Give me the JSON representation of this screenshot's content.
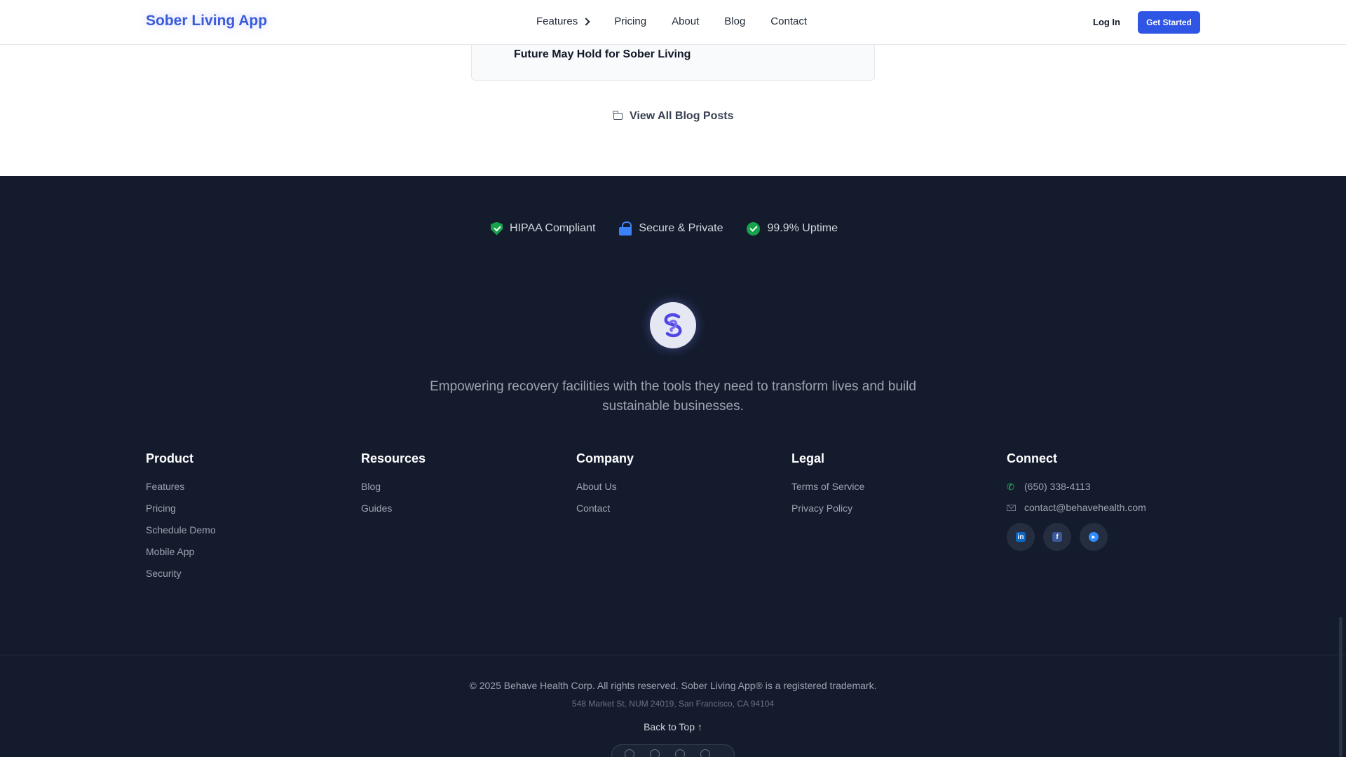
{
  "header": {
    "logo": "Sober Living App",
    "nav": [
      "Features",
      "Pricing",
      "About",
      "Blog",
      "Contact"
    ],
    "login": "Log In",
    "cta": "Get Started"
  },
  "blog": {
    "card_title": "Future May Hold for Sober Living",
    "view_all": "View All Blog Posts"
  },
  "footer": {
    "badges": [
      "HIPAA Compliant",
      "Secure & Private",
      "99.9% Uptime"
    ],
    "tagline": "Empowering recovery facilities with the tools they need to transform lives and build sustainable businesses.",
    "columns": {
      "product": {
        "title": "Product",
        "links": [
          "Features",
          "Pricing",
          "Schedule Demo",
          "Mobile App",
          "Security"
        ]
      },
      "resources": {
        "title": "Resources",
        "links": [
          "Blog",
          "Guides"
        ]
      },
      "company": {
        "title": "Company",
        "links": [
          "About Us",
          "Contact"
        ]
      },
      "legal": {
        "title": "Legal",
        "links": [
          "Terms of Service",
          "Privacy Policy"
        ]
      },
      "connect": {
        "title": "Connect",
        "phone": "(650) 338-4113",
        "email": "contact@behavehealth.com"
      }
    },
    "copyright": "© 2025 Behave Health Corp. All rights reserved. Sober Living App® is a registered trademark.",
    "address": "548 Market St, NUM 24019, San Francisco, CA 94104",
    "back_to_top": "Back to Top ↑"
  },
  "colors": {
    "accent": "#2f55e4",
    "footer_bg": "#141b2d",
    "success": "#16a34a"
  }
}
